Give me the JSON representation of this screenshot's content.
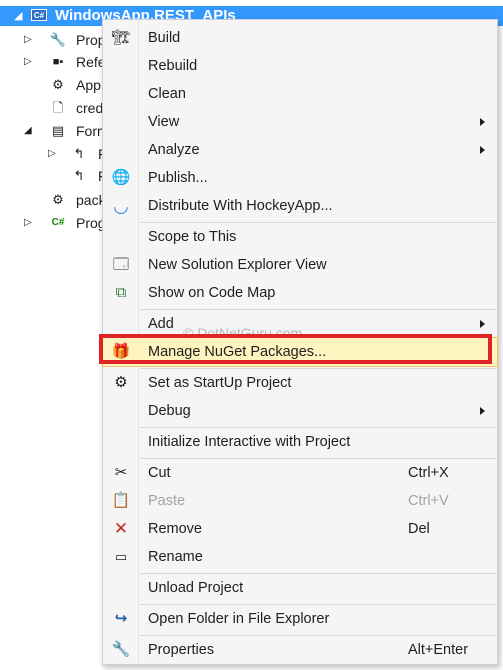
{
  "tree": {
    "project_title": "WindowsApp.REST_APIs",
    "nodes": [
      {
        "label": "Prop",
        "icon": "wrench-icon"
      },
      {
        "label": "Refe",
        "icon": "references-icon"
      },
      {
        "label": "App",
        "icon": "config-icon"
      },
      {
        "label": "cred",
        "icon": "file-icon"
      },
      {
        "label": "Form",
        "icon": "form-icon"
      },
      {
        "label": "F",
        "icon": "form-file-icon"
      },
      {
        "label": "F",
        "icon": "form-file-icon"
      },
      {
        "label": "pack",
        "icon": "config-icon"
      },
      {
        "label": "Prog",
        "icon": "csharp-icon"
      }
    ]
  },
  "menu": {
    "build": "Build",
    "rebuild": "Rebuild",
    "clean": "Clean",
    "view": "View",
    "analyze": "Analyze",
    "publish": "Publish...",
    "distribute": "Distribute With HockeyApp...",
    "scope": "Scope to This",
    "new_view": "New Solution Explorer View",
    "code_map": "Show on Code Map",
    "add": "Add",
    "nuget": "Manage NuGet Packages...",
    "startup": "Set as StartUp Project",
    "debug": "Debug",
    "interactive": "Initialize Interactive with Project",
    "cut": "Cut",
    "cut_sc": "Ctrl+X",
    "paste": "Paste",
    "paste_sc": "Ctrl+V",
    "remove": "Remove",
    "remove_sc": "Del",
    "rename": "Rename",
    "unload": "Unload Project",
    "open_folder": "Open Folder in File Explorer",
    "properties": "Properties",
    "properties_sc": "Alt+Enter"
  },
  "watermark": "© DotNetGuru.com",
  "colors": {
    "selection": "#3399ff",
    "highlight": "#fdf4bf",
    "annotation_box": "#e02424"
  }
}
